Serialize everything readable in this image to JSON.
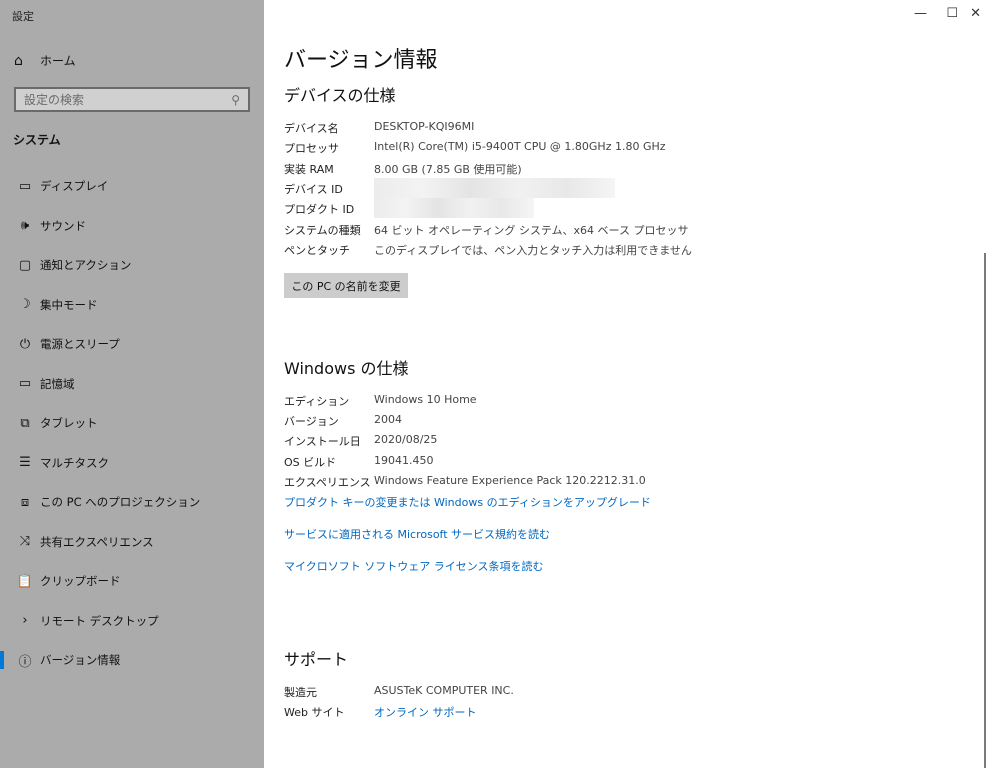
{
  "app_title": "設定",
  "window": {
    "minimize": "—",
    "maximize": "☐",
    "close": "✕"
  },
  "sidebar": {
    "home": "ホーム",
    "search_placeholder": "設定の検索",
    "section": "システム",
    "items": [
      {
        "label": "ディスプレイ",
        "icon": "display-icon"
      },
      {
        "label": "サウンド",
        "icon": "sound-icon"
      },
      {
        "label": "通知とアクション",
        "icon": "notification-icon"
      },
      {
        "label": "集中モード",
        "icon": "moon-icon"
      },
      {
        "label": "電源とスリープ",
        "icon": "power-icon"
      },
      {
        "label": "記憶域",
        "icon": "storage-icon"
      },
      {
        "label": "タブレット",
        "icon": "tablet-icon"
      },
      {
        "label": "マルチタスク",
        "icon": "multitask-icon"
      },
      {
        "label": "この PC へのプロジェクション",
        "icon": "projection-icon"
      },
      {
        "label": "共有エクスペリエンス",
        "icon": "shared-icon"
      },
      {
        "label": "クリップボード",
        "icon": "clipboard-icon"
      },
      {
        "label": "リモート デスクトップ",
        "icon": "remote-icon"
      },
      {
        "label": "バージョン情報",
        "icon": "info-icon",
        "active": true
      }
    ]
  },
  "main": {
    "title": "バージョン情報",
    "device": {
      "heading": "デバイスの仕様",
      "rows": [
        {
          "k": "デバイス名",
          "v": "DESKTOP-KQI96MI"
        },
        {
          "k": "プロセッサ",
          "v": "Intel(R) Core(TM) i5-9400T CPU @ 1.80GHz   1.80 GHz"
        },
        {
          "k": "実装 RAM",
          "v": "8.00 GB (7.85 GB 使用可能)"
        },
        {
          "k": "デバイス ID",
          "v": ""
        },
        {
          "k": "プロダクト ID",
          "v": ""
        },
        {
          "k": "システムの種類",
          "v": "64 ビット オペレーティング システム、x64 ベース プロセッサ"
        },
        {
          "k": "ペンとタッチ",
          "v": "このディスプレイでは、ペン入力とタッチ入力は利用できません"
        }
      ],
      "rename_button": "この PC の名前を変更"
    },
    "windows": {
      "heading": "Windows の仕様",
      "rows": [
        {
          "k": "エディション",
          "v": "Windows 10 Home"
        },
        {
          "k": "バージョン",
          "v": "2004"
        },
        {
          "k": "インストール日",
          "v": "2020/08/25"
        },
        {
          "k": "OS ビルド",
          "v": "19041.450"
        },
        {
          "k": "エクスペリエンス",
          "v": "Windows Feature Experience Pack 120.2212.31.0"
        }
      ],
      "links": [
        "プロダクト キーの変更または Windows のエディションをアップグレード",
        "サービスに適用される Microsoft サービス規約を読む",
        "マイクロソフト ソフトウェア ライセンス条項を読む"
      ]
    },
    "support": {
      "heading": "サポート",
      "rows": [
        {
          "k": "製造元",
          "v": "ASUSTeK COMPUTER INC."
        },
        {
          "k": "Web サイト",
          "v": "オンライン サポート"
        }
      ]
    }
  },
  "colors": {
    "accent": "#0078d7",
    "link": "#0067c0",
    "sidebar": "#ababab"
  }
}
